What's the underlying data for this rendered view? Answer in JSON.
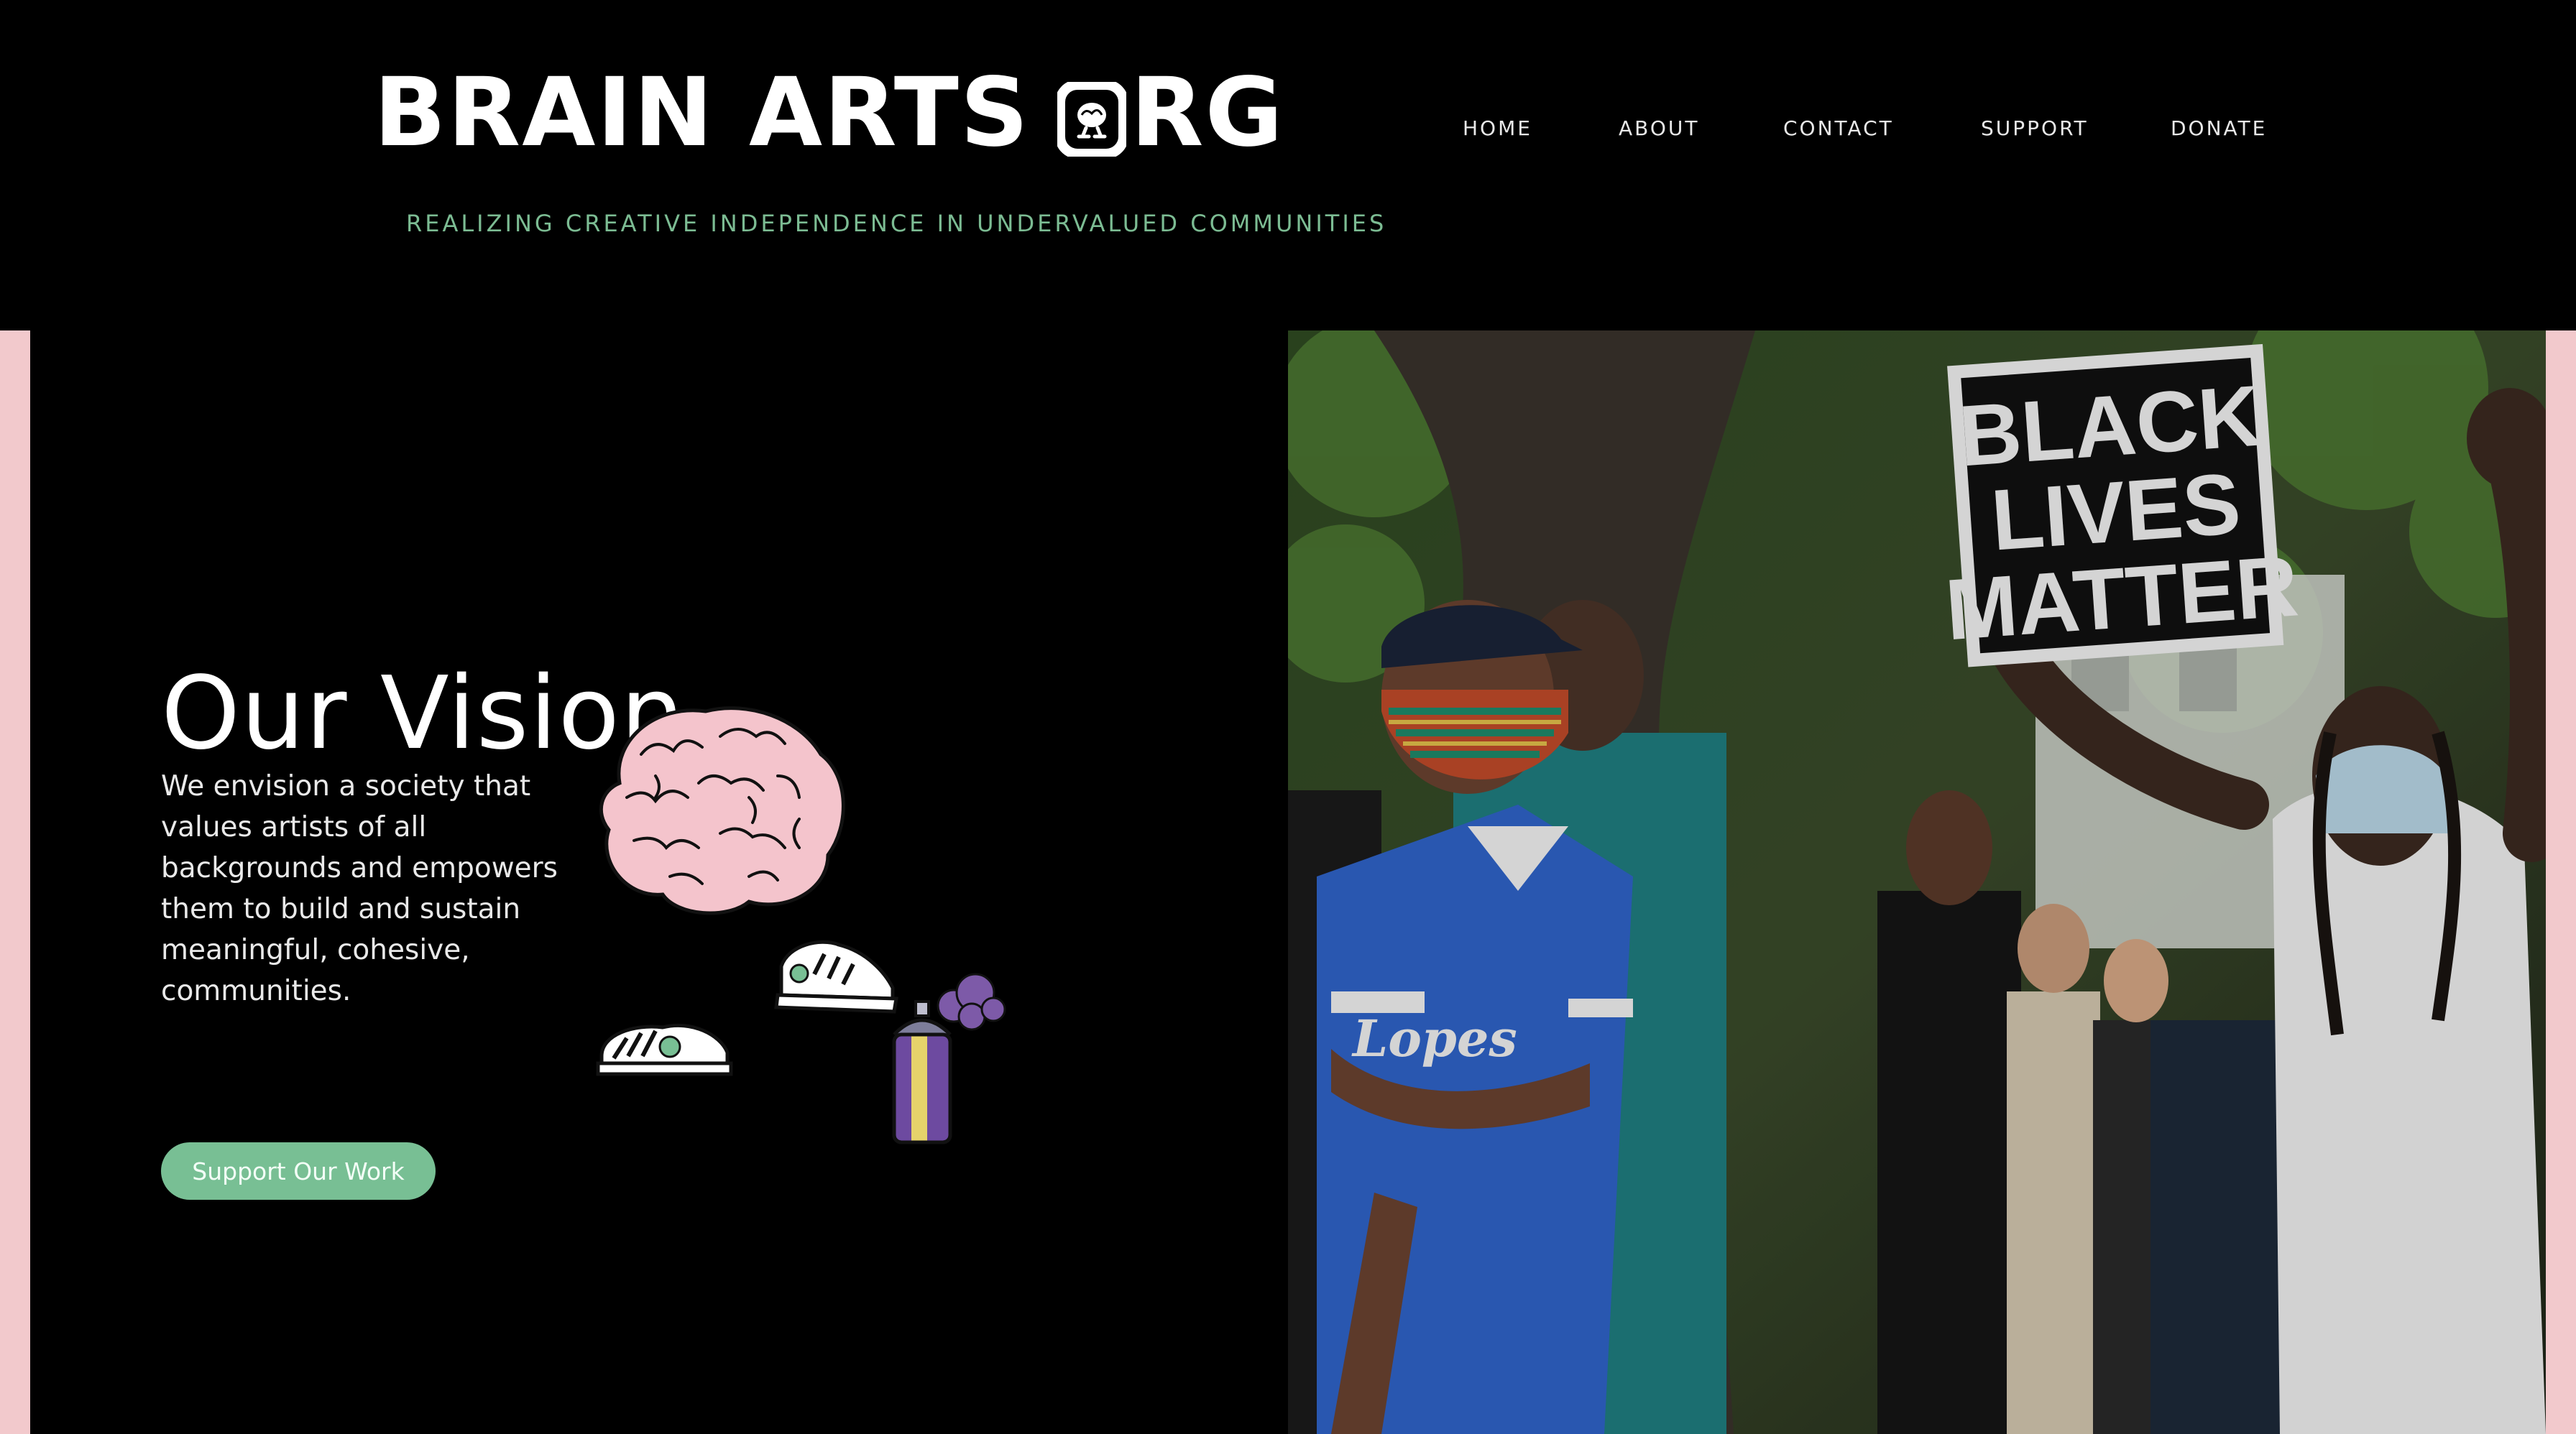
{
  "brand": {
    "name_part1": "BRAIN ARTS",
    "name_part2": "RG",
    "logo_icon": "brain-face-o-icon",
    "tagline": "REALIZING CREATIVE INDEPENDENCE IN UNDERVALUED COMMUNITIES"
  },
  "nav": {
    "items": [
      {
        "label": "HOME"
      },
      {
        "label": "ABOUT"
      },
      {
        "label": "CONTACT"
      },
      {
        "label": "SUPPORT"
      },
      {
        "label": "DONATE"
      }
    ]
  },
  "vision": {
    "title": "Our Vision",
    "body": "We envision a society that values artists of all backgrounds and empowers them to build and sustain meaningful, cohesive, communities.",
    "button_label": "Support Our Work",
    "illustration": "brain-with-legs-spray-can-illustration"
  },
  "photo": {
    "description_icon": "protest-photo",
    "sign_line1": "BLACK",
    "sign_line2": "LIVES",
    "sign_line3": "MATTER"
  },
  "colors": {
    "background": "#000000",
    "accent_green": "#78bf94",
    "tagline_green": "#7cbc93",
    "frame_pink": "#f2c9cc",
    "brain_pink": "#f4c4cc",
    "can_purple": "#6d4aa0"
  }
}
